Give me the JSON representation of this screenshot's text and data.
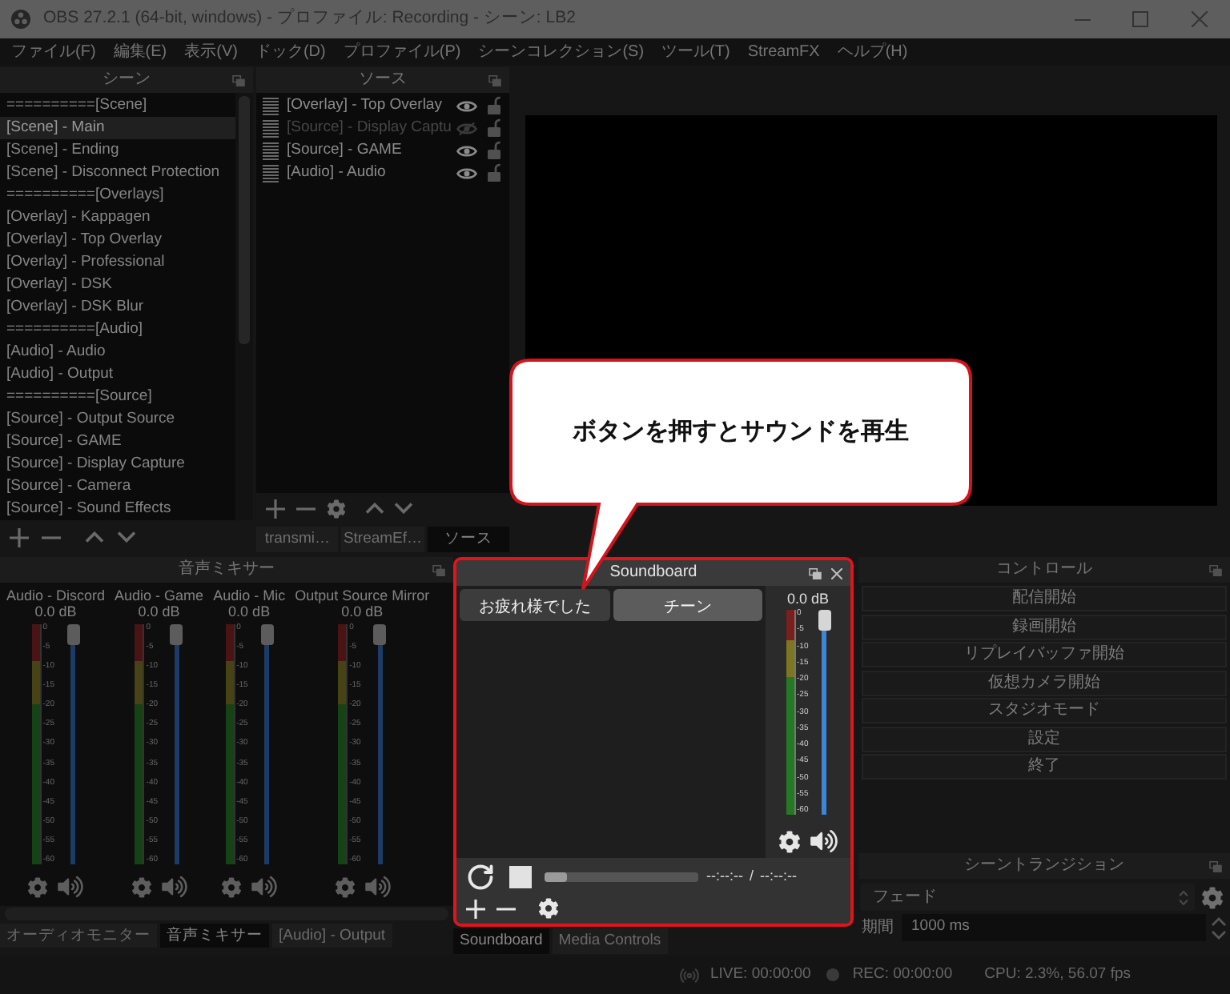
{
  "window": {
    "title": "OBS 27.2.1 (64-bit, windows) - プロファイル: Recording - シーン: LB2"
  },
  "menu": [
    "ファイル(F)",
    "編集(E)",
    "表示(V)",
    "ドック(D)",
    "プロファイル(P)",
    "シーンコレクション(S)",
    "ツール(T)",
    "StreamFX",
    "ヘルプ(H)"
  ],
  "scenes": {
    "title": "シーン",
    "items": [
      {
        "label": "==========[Scene]",
        "selected": false
      },
      {
        "label": "[Scene] - Main",
        "selected": true
      },
      {
        "label": "[Scene] - Ending",
        "selected": false
      },
      {
        "label": "[Scene] - Disconnect Protection",
        "selected": false
      },
      {
        "label": "==========[Overlays]",
        "selected": false
      },
      {
        "label": "[Overlay] - Kappagen",
        "selected": false
      },
      {
        "label": "[Overlay] - Top Overlay",
        "selected": false
      },
      {
        "label": "[Overlay] - Professional",
        "selected": false
      },
      {
        "label": "[Overlay] - DSK",
        "selected": false
      },
      {
        "label": "[Overlay] - DSK Blur",
        "selected": false
      },
      {
        "label": "==========[Audio]",
        "selected": false
      },
      {
        "label": "[Audio] - Audio",
        "selected": false
      },
      {
        "label": "[Audio] - Output",
        "selected": false
      },
      {
        "label": "==========[Source]",
        "selected": false
      },
      {
        "label": "[Source] - Output Source",
        "selected": false
      },
      {
        "label": "[Source] - GAME",
        "selected": false
      },
      {
        "label": "[Source] - Display Capture",
        "selected": false
      },
      {
        "label": "[Source] - Camera",
        "selected": false
      },
      {
        "label": "[Source] - Sound Effects",
        "selected": false
      }
    ]
  },
  "sources": {
    "title": "ソース",
    "items": [
      {
        "label": "[Overlay] - Top Overlay",
        "visible": true,
        "locked": false
      },
      {
        "label": "[Source] - Display Captu",
        "visible": false,
        "locked": false
      },
      {
        "label": "[Source] - GAME",
        "visible": true,
        "locked": false
      },
      {
        "label": "[Audio] - Audio",
        "visible": true,
        "locked": false
      }
    ],
    "tabs": [
      {
        "label": "transmi…",
        "selected": false
      },
      {
        "label": "StreamEf…",
        "selected": false
      },
      {
        "label": "ソース",
        "selected": true
      }
    ]
  },
  "mixer": {
    "title": "音声ミキサー",
    "channels": [
      {
        "name": "Audio - Discord",
        "reading": "0.0 dB",
        "level": 1,
        "scale": [
          "0",
          "-5",
          "-10",
          "-15",
          "-20",
          "-25",
          "-30",
          "-35",
          "-40",
          "-45",
          "-50",
          "-55",
          "-60"
        ]
      },
      {
        "name": "Audio - Game",
        "reading": "0.0 dB",
        "level": 1,
        "scale": [
          "0",
          "-5",
          "-10",
          "-15",
          "-20",
          "-25",
          "-30",
          "-35",
          "-40",
          "-45",
          "-50",
          "-55",
          "-60"
        ]
      },
      {
        "name": "Audio - Mic",
        "reading": "0.0 dB",
        "level": 1,
        "scale": [
          "0",
          "-5",
          "-10",
          "-15",
          "-20",
          "-25",
          "-30",
          "-35",
          "-40",
          "-45",
          "-50",
          "-55",
          "-60"
        ]
      },
      {
        "name": "Output Source Mirror",
        "reading": "0.0 dB",
        "level": 1,
        "scale": [
          "0",
          "-5",
          "-10",
          "-15",
          "-20",
          "-25",
          "-30",
          "-35",
          "-40",
          "-45",
          "-50",
          "-55",
          "-60"
        ]
      }
    ],
    "tabs": [
      {
        "label": "オーディオモニター",
        "selected": false
      },
      {
        "label": "音声ミキサー",
        "selected": true
      },
      {
        "label": "[Audio] - Output",
        "selected": false
      }
    ]
  },
  "soundboard": {
    "title": "Soundboard",
    "buttons": [
      {
        "label": "お疲れ様でした",
        "selected": false
      },
      {
        "label": "チーン",
        "selected": true
      }
    ],
    "meter": {
      "reading": "0.0 dB",
      "level": 1,
      "scale": [
        "0",
        "-5",
        "-10",
        "-15",
        "-20",
        "-25",
        "-30",
        "-35",
        "-40",
        "-45",
        "-50",
        "-55",
        "-60"
      ]
    },
    "playback": {
      "level": 0,
      "elapsed": "--:--:--",
      "separator": "/",
      "duration": "--:--:--"
    },
    "tabs": [
      {
        "label": "Soundboard",
        "selected": true
      },
      {
        "label": "Media Controls",
        "selected": false
      }
    ]
  },
  "controls": {
    "title": "コントロール",
    "buttons": [
      "配信開始",
      "録画開始",
      "リプレイバッファ開始",
      "仮想カメラ開始",
      "スタジオモード",
      "設定",
      "終了"
    ]
  },
  "transitions": {
    "title": "シーントランジション",
    "transition": "フェード",
    "duration_label": "期間",
    "duration": "1000 ms"
  },
  "status_bar": {
    "live": "LIVE: 00:00:00",
    "rec": "REC: 00:00:00",
    "cpu": "CPU: 2.3%, 56.07 fps"
  },
  "callout": {
    "text": "ボタンを押すとサウンドを再生"
  }
}
